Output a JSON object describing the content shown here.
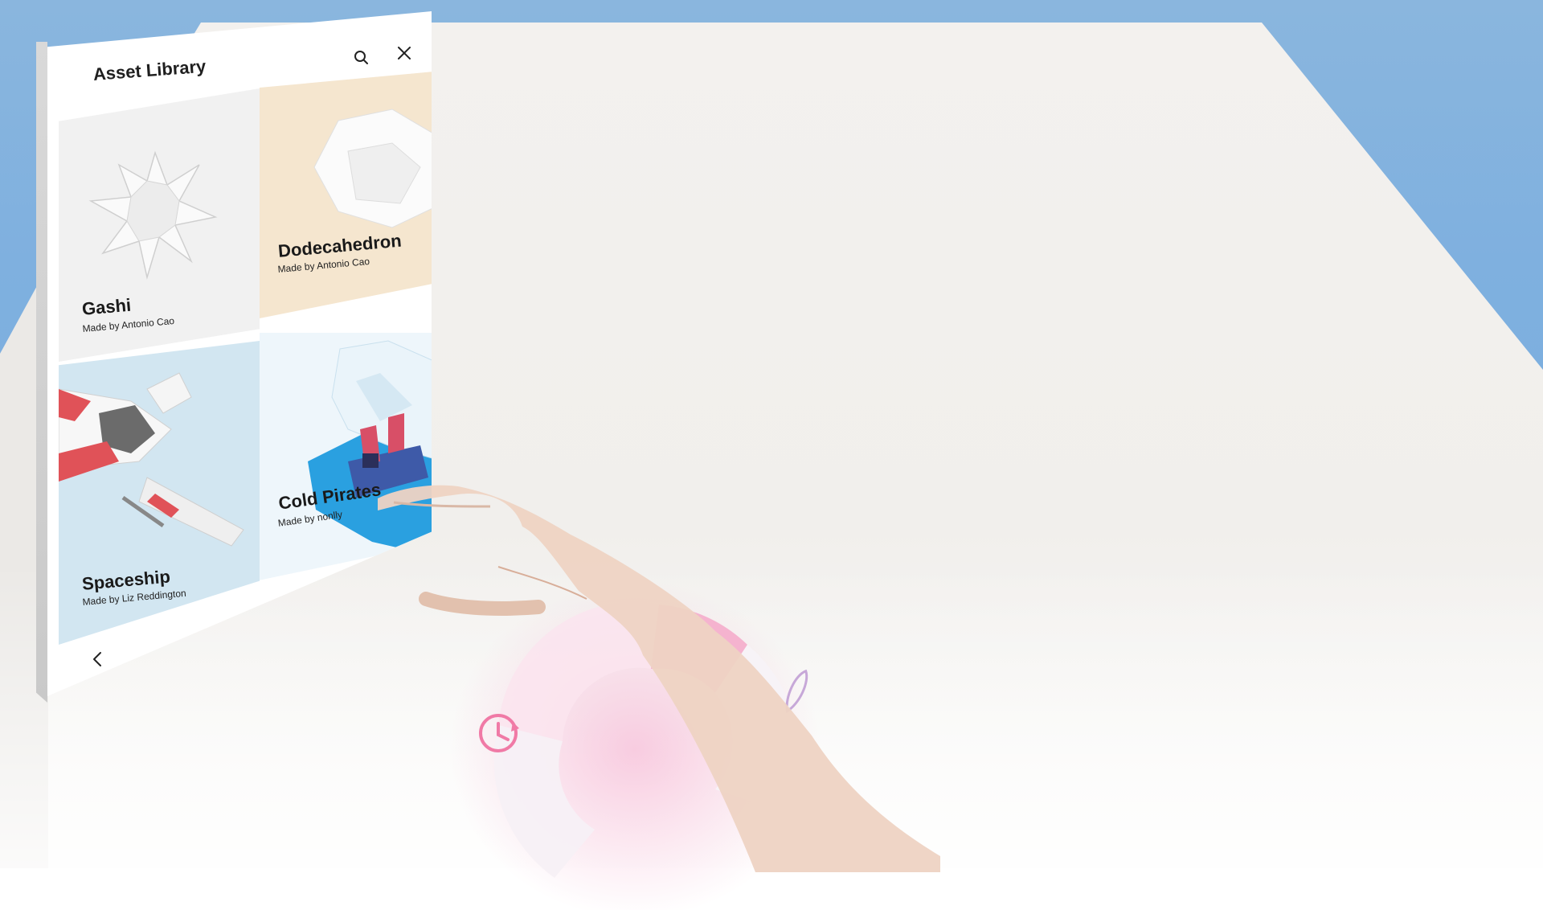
{
  "panel": {
    "title": "Asset Library",
    "search_icon": "search-icon",
    "close_icon": "close-icon"
  },
  "assets": [
    {
      "name": "Gashi",
      "credit": "Made by Antonio Cao"
    },
    {
      "name": "Dodecahedron",
      "credit": "Made by Antonio Cao"
    },
    {
      "name": "Spaceship",
      "credit": "Made by Liz Reddington"
    },
    {
      "name": "Cold Pirates",
      "credit": "Made by nonlly"
    }
  ],
  "nav": {
    "prev_icon": "chevron-left-icon",
    "next_icon": "chevron-right-icon"
  },
  "radial_menu": {
    "history_icon": "history-icon",
    "pen_icon": "pen-icon"
  },
  "colors": {
    "sky": "#7fb0df",
    "gashi_tile": "#f1f1f1",
    "dodeca_tile": "#f5e6cf",
    "ship_tile": "#d2e6f1",
    "radial_accent": "#f48fb8"
  }
}
